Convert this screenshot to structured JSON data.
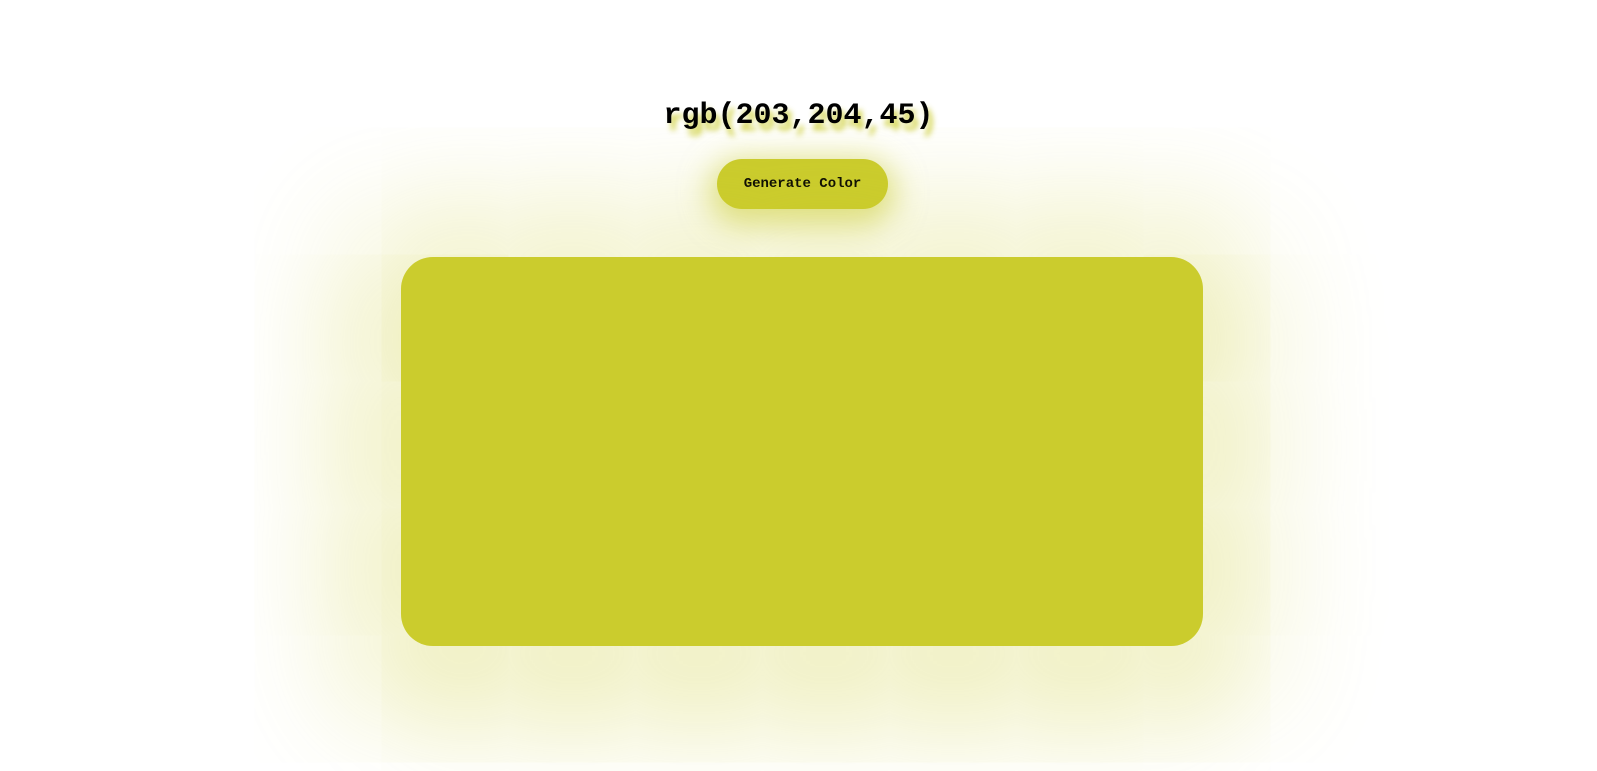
{
  "color": {
    "label": "rgb(203,204,45)",
    "hex": "#cbcc2d"
  },
  "controls": {
    "generate_label": "Generate Color"
  },
  "page_background": "#ffffff",
  "text_color": "#000000"
}
